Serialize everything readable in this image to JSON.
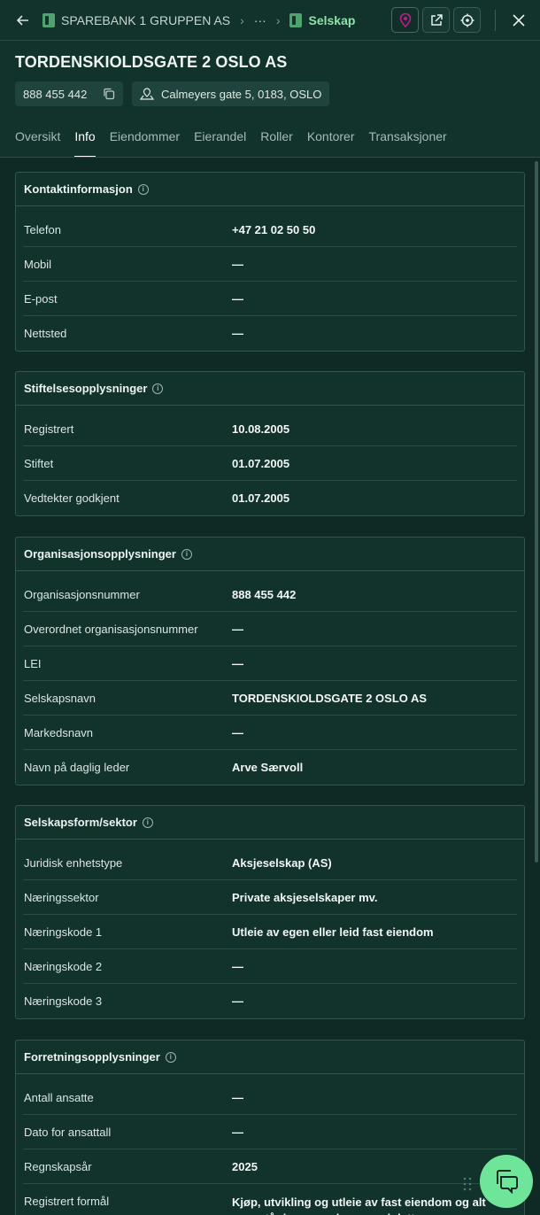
{
  "breadcrumb": {
    "items": [
      "SPAREBANK 1 GRUPPEN AS",
      "···",
      "Selskap"
    ]
  },
  "header": {
    "title": "TORDENSKIOLDSGATE 2 OSLO AS",
    "org_number": "888 455 442",
    "address": "Calmeyers gate 5, 0183, OSLO"
  },
  "tabs": [
    "Oversikt",
    "Info",
    "Eiendommer",
    "Eierandel",
    "Roller",
    "Kontorer",
    "Transaksjoner"
  ],
  "active_tab": "Info",
  "colors": {
    "accent": "#6fe59a",
    "background": "#12322c",
    "map_pin": "#c21b8a"
  },
  "sections": [
    {
      "title": "Kontaktinformasjon",
      "rows": [
        {
          "label": "Telefon",
          "value": "+47 21 02 50 50"
        },
        {
          "label": "Mobil",
          "value": "—"
        },
        {
          "label": "E-post",
          "value": "—"
        },
        {
          "label": "Nettsted",
          "value": "—"
        }
      ]
    },
    {
      "title": "Stiftelsesopplysninger",
      "rows": [
        {
          "label": "Registrert",
          "value": "10.08.2005"
        },
        {
          "label": "Stiftet",
          "value": "01.07.2005"
        },
        {
          "label": "Vedtekter godkjent",
          "value": "01.07.2005"
        }
      ]
    },
    {
      "title": "Organisasjonsopplysninger",
      "rows": [
        {
          "label": "Organisasjonsnummer",
          "value": "888 455 442"
        },
        {
          "label": "Overordnet organisasjonsnummer",
          "value": "—"
        },
        {
          "label": "LEI",
          "value": "—"
        },
        {
          "label": "Selskapsnavn",
          "value": "TORDENSKIOLDSGATE 2 OSLO AS"
        },
        {
          "label": "Markedsnavn",
          "value": "—"
        },
        {
          "label": "Navn på daglig leder",
          "value": "Arve Særvoll"
        }
      ]
    },
    {
      "title": "Selskapsform/sektor",
      "rows": [
        {
          "label": "Juridisk enhetstype",
          "value": "Aksjeselskap (AS)"
        },
        {
          "label": "Næringssektor",
          "value": "Private aksjeselskaper mv."
        },
        {
          "label": "Næringskode 1",
          "value": "Utleie av egen eller leid fast eiendom"
        },
        {
          "label": "Næringskode 2",
          "value": "—"
        },
        {
          "label": "Næringskode 3",
          "value": "—"
        }
      ]
    },
    {
      "title": "Forretningsopplysninger",
      "rows": [
        {
          "label": "Antall ansatte",
          "value": "—"
        },
        {
          "label": "Dato for ansattall",
          "value": "—"
        },
        {
          "label": "Regnskapsår",
          "value": "2025"
        },
        {
          "label": "Registrert formål",
          "value": "Kjøp, utvikling og utleie av fast eiendom og alt som står i sammenheng med dette"
        }
      ]
    }
  ]
}
